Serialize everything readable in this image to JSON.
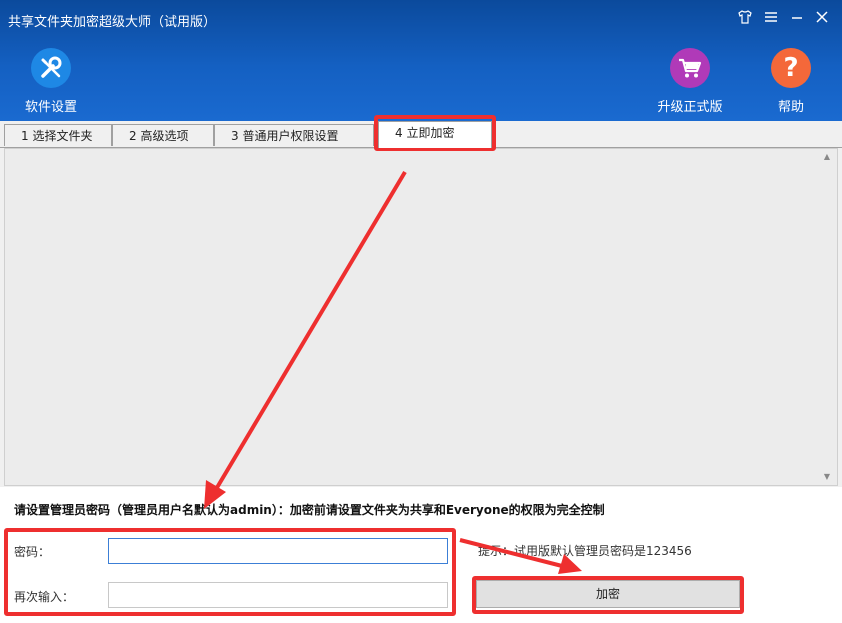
{
  "window": {
    "title": "共享文件夹加密超级大师（试用版）",
    "controls": [
      "skin-icon",
      "menu-icon",
      "minimize-icon",
      "close-icon"
    ]
  },
  "toolbar": {
    "settings_label": "软件设置",
    "upgrade_label": "升级正式版",
    "help_label": "帮助",
    "help_glyph": "?",
    "colors": {
      "settings": "#1e88e5",
      "upgrade": "#b03ab8",
      "help": "#f4683a"
    }
  },
  "tabs": [
    {
      "label": "1 选择文件夹"
    },
    {
      "label": "2 高级选项"
    },
    {
      "label": "3 普通用户权限设置"
    },
    {
      "label": "4 立即加密"
    }
  ],
  "form": {
    "note": "请设置管理员密码（管理员用户名默认为admin）：加密前请设置文件夹为共享和Everyone的权限为完全控制",
    "password_label": "密码：",
    "password_value": "",
    "confirm_label": "再次输入：",
    "confirm_value": "",
    "hint": "提示：试用版默认管理员密码是123456",
    "encrypt_label": "加密"
  },
  "annotation_color": "#ee2f2f"
}
